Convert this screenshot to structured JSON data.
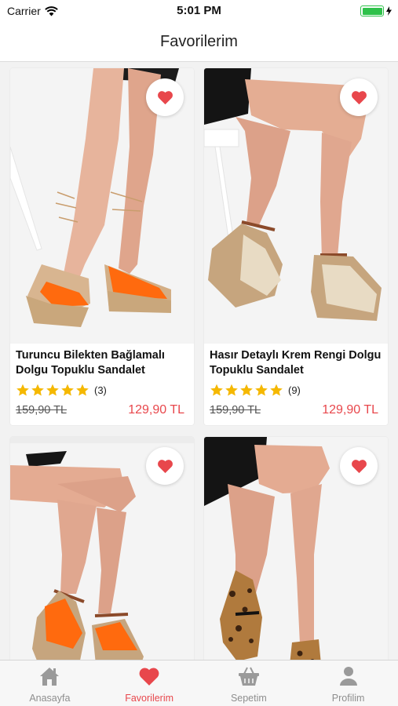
{
  "status_bar": {
    "carrier": "Carrier",
    "time": "5:01 PM",
    "battery_level": 1.0
  },
  "nav": {
    "title": "Favorilerim"
  },
  "colors": {
    "accent": "#e8474c",
    "star": "#f5b800",
    "battery": "#2ec14a"
  },
  "products": [
    {
      "name": "Turuncu Bilekten Bağlamalı Dolgu Topuklu Sandalet",
      "rating": 5,
      "rating_count": "(3)",
      "old_price": "159,90 TL",
      "new_price": "129,90 TL",
      "favorited": true,
      "image": "orange-lace-up-wedge-sandal"
    },
    {
      "name": "Hasır Detaylı Krem Rengi Dolgu Topuklu Sandalet",
      "rating": 5,
      "rating_count": "(9)",
      "old_price": "159,90 TL",
      "new_price": "129,90 TL",
      "favorited": true,
      "image": "cream-espadrille-wedge-sandal"
    },
    {
      "name": "",
      "rating": 0,
      "rating_count": "",
      "old_price": "",
      "new_price": "",
      "favorited": true,
      "image": "orange-wedge-sandal-brown-strap"
    },
    {
      "name": "",
      "rating": 0,
      "rating_count": "",
      "old_price": "",
      "new_price": "",
      "favorited": true,
      "image": "leopard-print-flat-shoe"
    }
  ],
  "tabs": [
    {
      "label": "Anasayfa",
      "icon": "home-icon",
      "active": false
    },
    {
      "label": "Favorilerim",
      "icon": "heart-icon",
      "active": true
    },
    {
      "label": "Sepetim",
      "icon": "basket-icon",
      "active": false
    },
    {
      "label": "Profilim",
      "icon": "person-icon",
      "active": false
    }
  ]
}
